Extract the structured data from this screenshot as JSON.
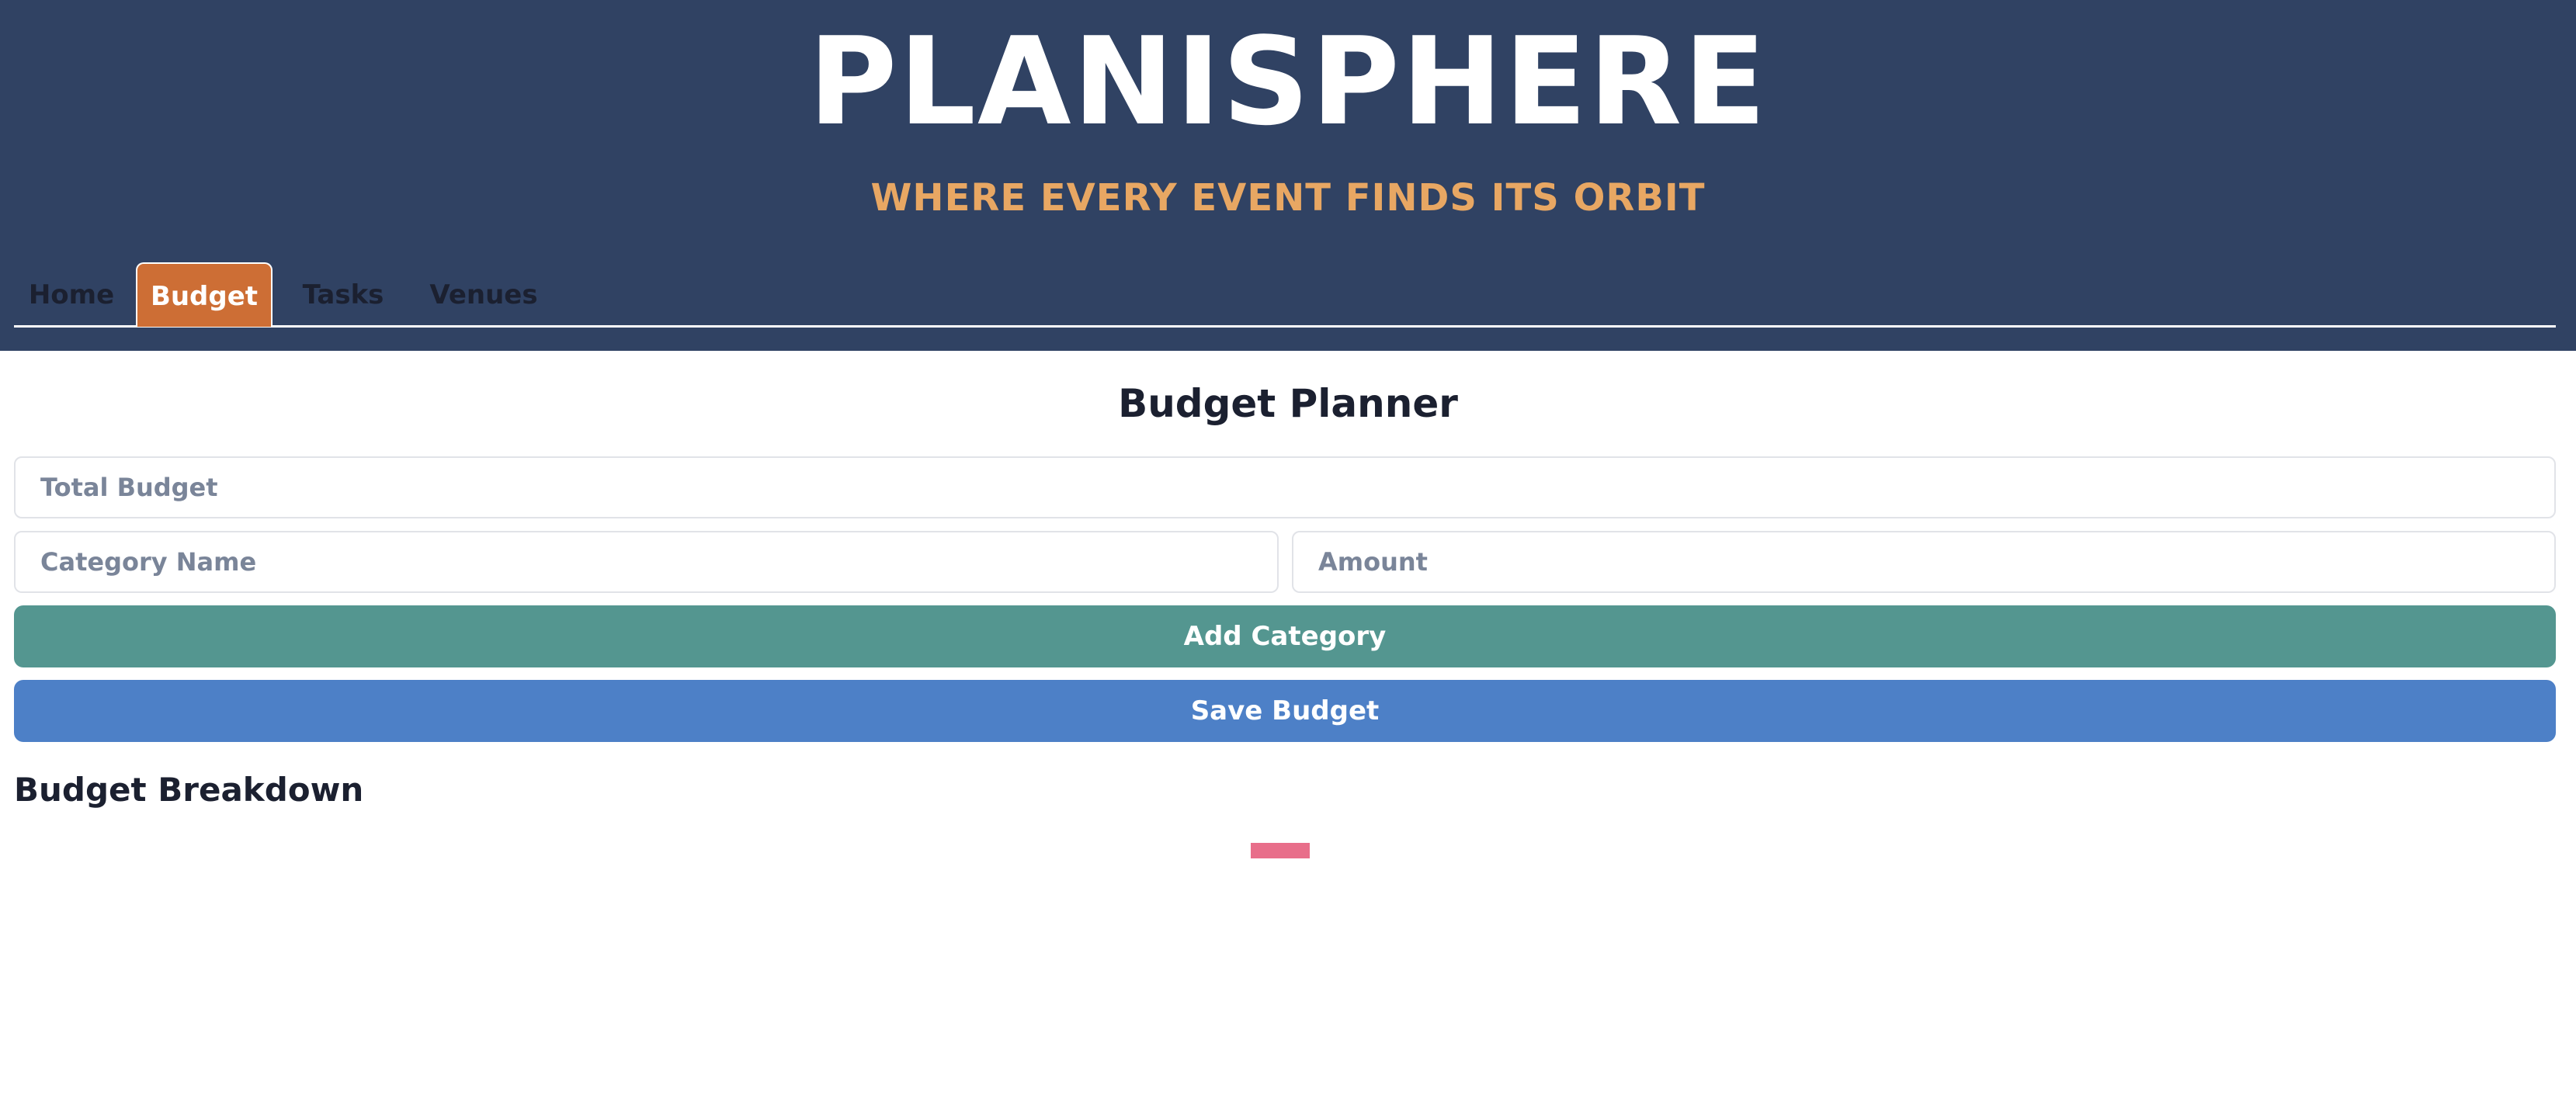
{
  "header": {
    "title": "PLANISPHERE",
    "tagline": "WHERE EVERY EVENT FINDS ITS ORBIT"
  },
  "tabs": [
    {
      "label": "Home",
      "active": false
    },
    {
      "label": "Budget",
      "active": true
    },
    {
      "label": "Tasks",
      "active": false
    },
    {
      "label": "Venues",
      "active": false
    }
  ],
  "main": {
    "title": "Budget Planner",
    "total_budget_placeholder": "Total Budget",
    "category_name_placeholder": "Category Name",
    "amount_placeholder": "Amount",
    "add_category_label": "Add Category",
    "save_budget_label": "Save Budget",
    "breakdown_title": "Budget Breakdown"
  },
  "colors": {
    "header_bg": "#304263",
    "tagline": "#e8a763",
    "active_tab": "#cd6e35",
    "add_button": "#549690",
    "save_button": "#4d80c7",
    "chart_swatch": "#e86e8a"
  }
}
